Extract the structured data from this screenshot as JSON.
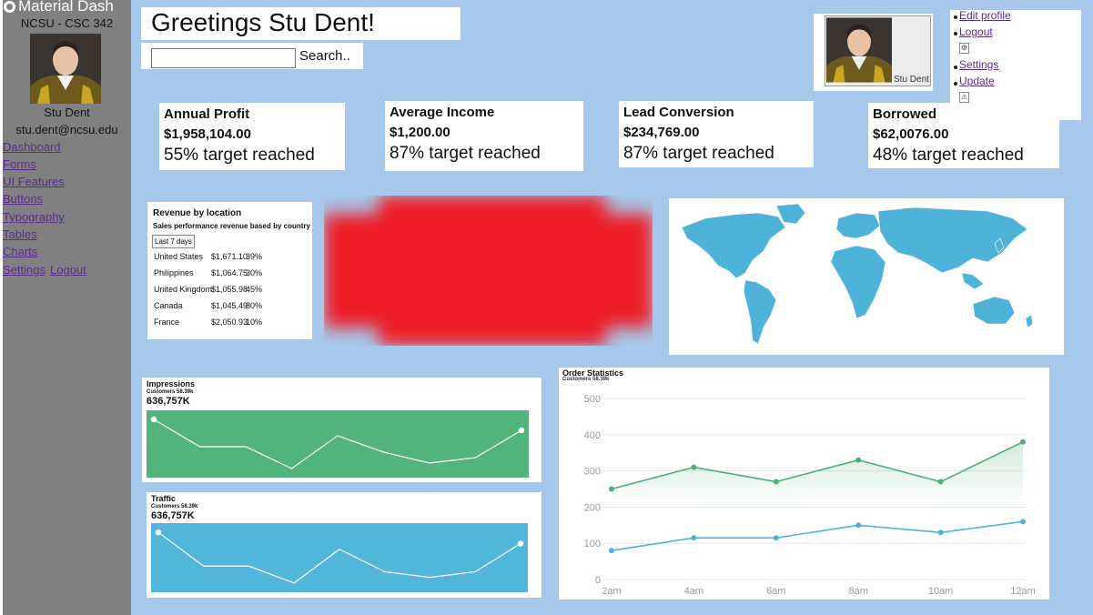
{
  "sidebar": {
    "brand": "Material Dash",
    "org": "NCSU - CSC 342",
    "user_name": "Stu Dent",
    "email": "stu.dent@ncsu.edu",
    "nav": [
      {
        "label": "Dashboard"
      },
      {
        "label": "Forms"
      },
      {
        "label": "UI Features"
      },
      {
        "label": "Buttons"
      },
      {
        "label": "Typography"
      },
      {
        "label": "Tables"
      },
      {
        "label": "Charts"
      },
      {
        "label": "Settings"
      }
    ],
    "logout_label": "Logout"
  },
  "header": {
    "greeting": "Greetings Stu Dent!",
    "search_button": "Search.."
  },
  "profile": {
    "name": "Stu Dent",
    "menu": [
      "Edit profile",
      "Logout",
      "Settings",
      "Update"
    ]
  },
  "stats": [
    {
      "title": "Annual Profit",
      "value": "$1,958,104.00",
      "progress": "55% target reached"
    },
    {
      "title": "Average Income",
      "value": "$1,200.00",
      "progress": "87% target reached"
    },
    {
      "title": "Lead Conversion",
      "value": "$234,769.00",
      "progress": "87% target reached"
    },
    {
      "title": "Borrowed",
      "value": "$62,0076.00",
      "progress": "48% target reached"
    }
  ],
  "revenue": {
    "title": "Revenue by location",
    "subtitle": "Sales performance revenue based by country",
    "range_button": "Last 7 days",
    "rows": [
      {
        "country": "United States",
        "amount": "$1,671.10",
        "pct": "39%"
      },
      {
        "country": "Philippines",
        "amount": "$1,064.75",
        "pct": "30%"
      },
      {
        "country": "United Kingdom",
        "amount": "$1,055.98",
        "pct": "45%"
      },
      {
        "country": "Canada",
        "amount": "$1,045.49",
        "pct": "80%"
      },
      {
        "country": "France",
        "amount": "$2,050.93",
        "pct": "10%"
      }
    ]
  },
  "impressions": {
    "title": "Impressions",
    "subtitle": "Customers 58.39k",
    "value": "636,757K",
    "color": "#52b47c"
  },
  "traffic": {
    "title": "Traffic",
    "subtitle": "Customers 58.39k",
    "value": "636,757K",
    "color": "#51b6da"
  },
  "order_statistics": {
    "title": "Order Statistics",
    "subtitle": "Customers 58.39k"
  },
  "colors": {
    "page_bg": "#a6c8ea",
    "sidebar_bg": "#808080",
    "link": "#5a2d8c",
    "map_land": "#4fb3d9",
    "red_blob": "#ee1c25"
  },
  "chart_data": [
    {
      "type": "line",
      "series": [
        {
          "values": [
            10,
            5,
            5,
            1,
            7,
            4,
            2,
            3,
            8
          ]
        }
      ],
      "ylim": [
        0,
        11
      ]
    },
    {
      "type": "line",
      "series": [
        {
          "values": [
            10,
            4,
            4,
            1,
            7,
            3,
            2,
            3,
            8
          ]
        }
      ],
      "ylim": [
        0,
        11
      ]
    },
    {
      "type": "line",
      "title": "Order Statistics",
      "x": [
        "2am",
        "4am",
        "6am",
        "8am",
        "10am",
        "12am"
      ],
      "x_positions": [
        2,
        4,
        5,
        6,
        8,
        9,
        10,
        12
      ],
      "series": [
        {
          "color": "#4caf7d",
          "points": [
            [
              2,
              250
            ],
            [
              4,
              310
            ],
            [
              6,
              270
            ],
            [
              8,
              330
            ],
            [
              10,
              270
            ],
            [
              12,
              380
            ]
          ]
        },
        {
          "color": "#4fb3d9",
          "points": [
            [
              2,
              80
            ],
            [
              4,
              115
            ],
            [
              6,
              115
            ],
            [
              8,
              150
            ],
            [
              10,
              130
            ],
            [
              12,
              160
            ]
          ]
        }
      ],
      "yticks": [
        0,
        100,
        200,
        300,
        400,
        500
      ],
      "ylim": [
        0,
        500
      ],
      "grid": true
    }
  ]
}
